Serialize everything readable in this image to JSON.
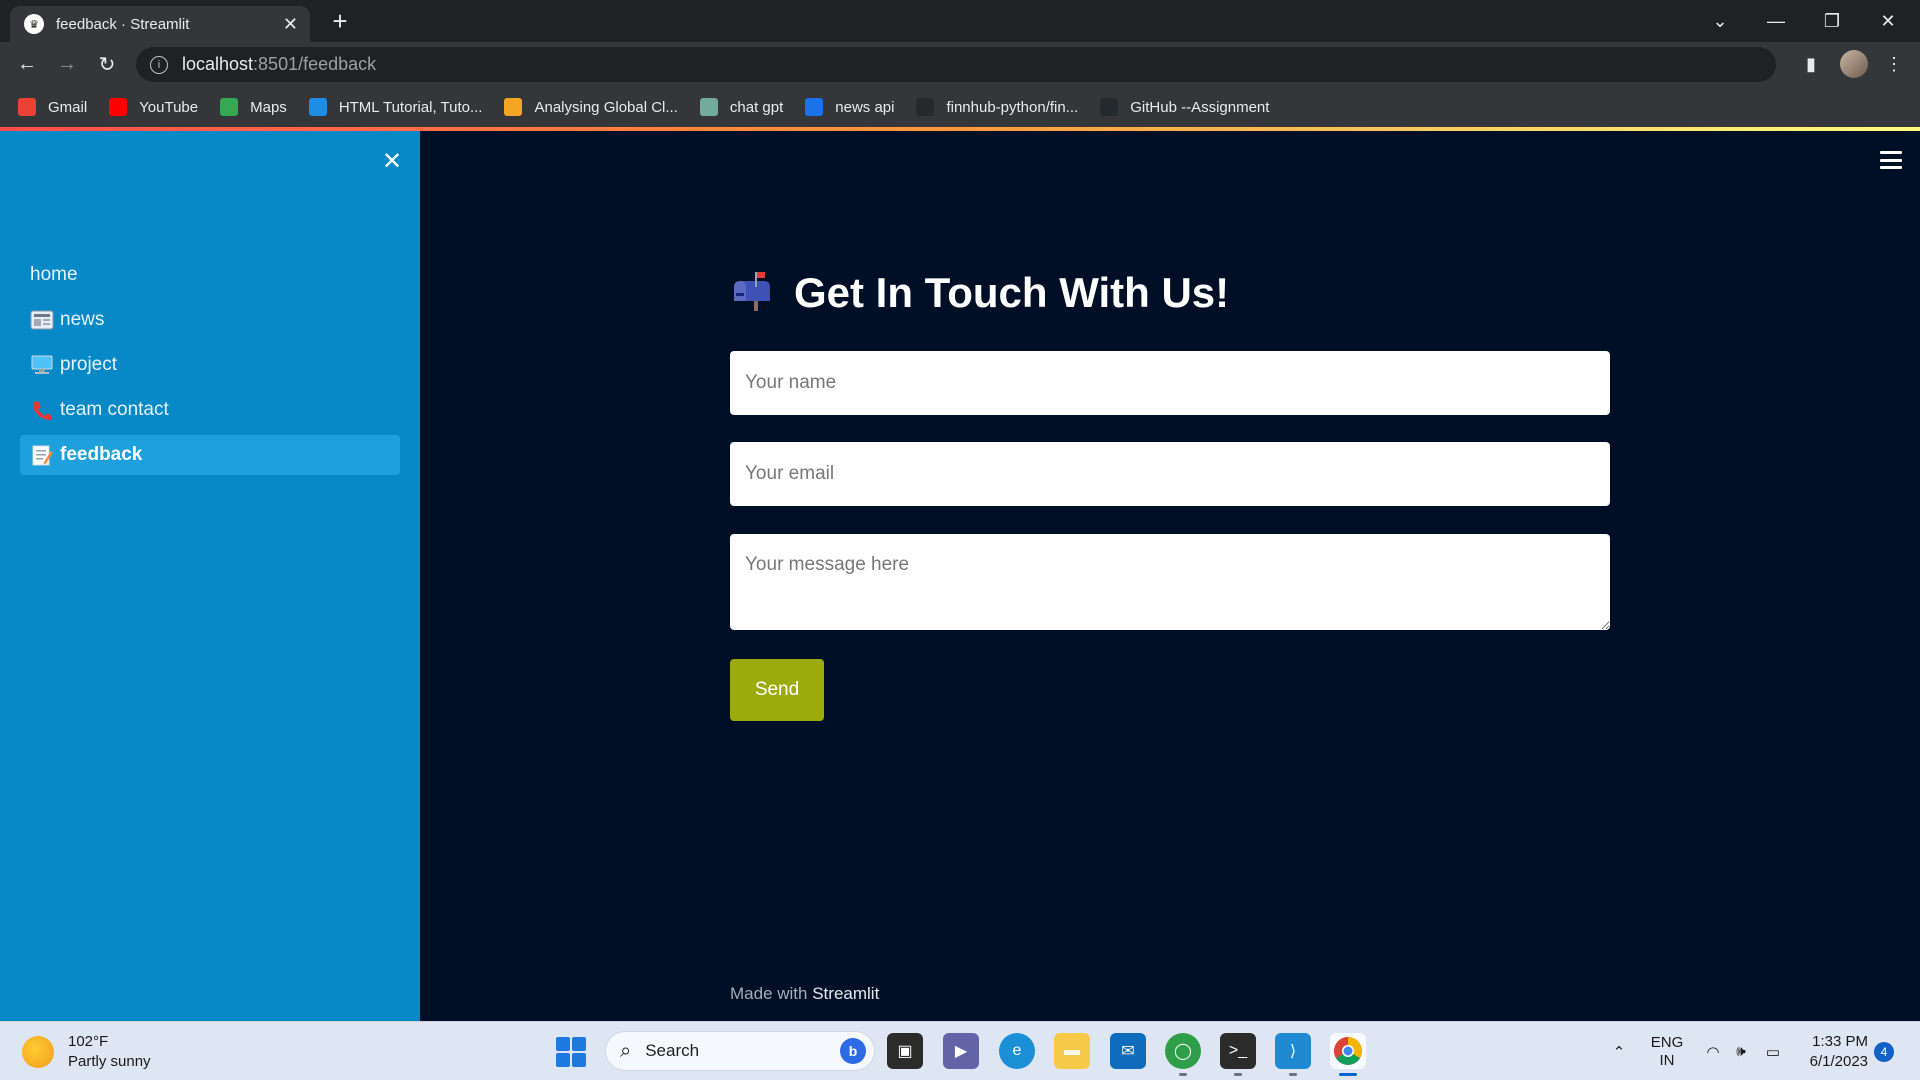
{
  "browser": {
    "tab_title": "feedback · Streamlit",
    "url_host": "localhost",
    "url_path": ":8501/feedback",
    "bookmarks": [
      {
        "label": "Gmail",
        "icon": "gmail-icon",
        "color": "#ea4335"
      },
      {
        "label": "YouTube",
        "icon": "youtube-icon",
        "color": "#ff0000"
      },
      {
        "label": "Maps",
        "icon": "maps-icon",
        "color": "#34a853"
      },
      {
        "label": "HTML Tutorial, Tuto...",
        "icon": "w3schools-icon",
        "color": "#1d8ee6"
      },
      {
        "label": "Analysing Global Cl...",
        "icon": "analysis-icon",
        "color": "#f4a623"
      },
      {
        "label": "chat gpt",
        "icon": "openai-icon",
        "color": "#74aa9c"
      },
      {
        "label": "news api",
        "icon": "newsapi-icon",
        "color": "#1a73e8"
      },
      {
        "label": "finnhub-python/fin...",
        "icon": "github-icon",
        "color": "#24292e"
      },
      {
        "label": "GitHub --Assignment",
        "icon": "github-icon",
        "color": "#24292e"
      }
    ]
  },
  "sidebar": {
    "items": [
      {
        "label": "home",
        "icon": "",
        "active": false
      },
      {
        "label": "news",
        "icon": "newspaper-icon",
        "active": false
      },
      {
        "label": "project",
        "icon": "computer-icon",
        "active": false
      },
      {
        "label": "team contact",
        "icon": "telephone-icon",
        "active": false
      },
      {
        "label": "feedback",
        "icon": "memo-icon",
        "active": true
      }
    ]
  },
  "main": {
    "title": "Get In Touch With Us!",
    "name_placeholder": "Your name",
    "email_placeholder": "Your email",
    "message_placeholder": "Your message here",
    "send_label": "Send",
    "footer_prefix": "Made with",
    "footer_brand": "Streamlit"
  },
  "taskbar": {
    "temperature": "102°F",
    "weather": "Partly sunny",
    "search_label": "Search",
    "lang_line1": "ENG",
    "lang_line2": "IN",
    "time": "1:33 PM",
    "date": "6/1/2023",
    "notification_count": "4"
  },
  "colors": {
    "sidebar_bg": "#0789c8",
    "main_bg": "#000f26",
    "send_button": "#9aab0b"
  }
}
